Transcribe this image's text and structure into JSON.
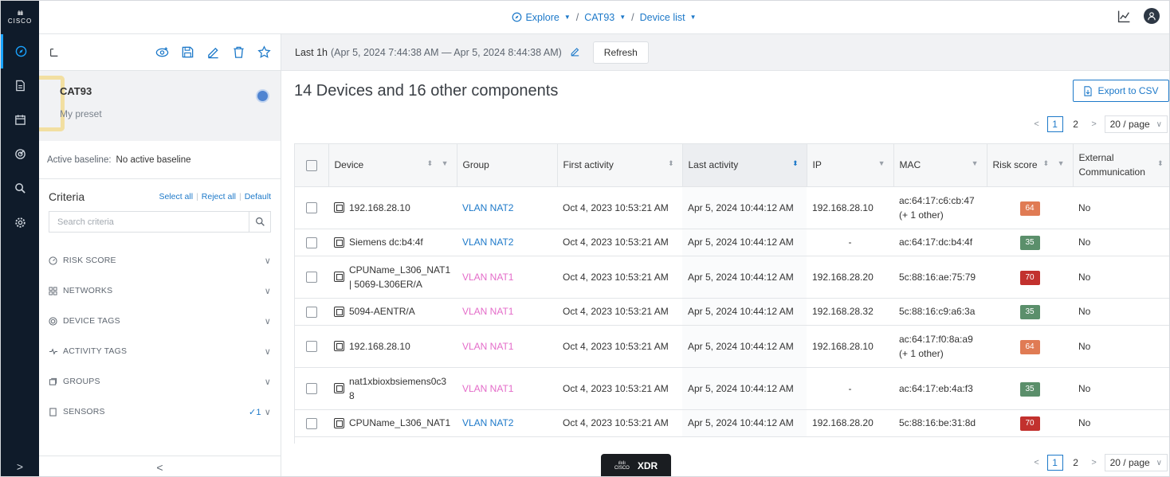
{
  "brand": {
    "bars": "ılıılı",
    "word": "CISCO"
  },
  "topbar": {
    "explore": "Explore",
    "preset": "CAT93",
    "view": "Device list"
  },
  "left_panel": {
    "preset_name": "CAT93",
    "preset_sub": "My preset",
    "baseline_label": "Active baseline:",
    "baseline_value": "No active baseline",
    "criteria_title": "Criteria",
    "select_all": "Select all",
    "reject_all": "Reject all",
    "default": "Default",
    "search_placeholder": "Search criteria",
    "criteria": [
      {
        "label": "RISK SCORE"
      },
      {
        "label": "NETWORKS"
      },
      {
        "label": "DEVICE TAGS"
      },
      {
        "label": "ACTIVITY TAGS"
      },
      {
        "label": "GROUPS"
      },
      {
        "label": "SENSORS",
        "count": "✓1"
      }
    ]
  },
  "main": {
    "time_label": "Last 1h",
    "time_range": "(Apr 5, 2024 7:44:38 AM — Apr 5, 2024 8:44:38 AM)",
    "refresh": "Refresh",
    "title": "14 Devices and 16 other components",
    "export": "Export to CSV",
    "pager": {
      "page1": "1",
      "page2": "2",
      "size": "20 / page"
    }
  },
  "table": {
    "columns": [
      "Device",
      "Group",
      "First activity",
      "Last activity",
      "IP",
      "MAC",
      "Risk score",
      "External Communication"
    ],
    "rows": [
      {
        "device": "192.168.28.10",
        "group": "VLAN NAT2",
        "group_color": "blue",
        "first": "Oct 4, 2023 10:53:21 AM",
        "last": "Apr 5, 2024 10:44:12 AM",
        "ip": "192.168.28.10",
        "mac": "ac:64:17:c6:cb:47",
        "mac2": "(+ 1 other)",
        "risk": "64",
        "ext": "No"
      },
      {
        "device": "Siemens dc:b4:4f",
        "group": "VLAN NAT2",
        "group_color": "blue",
        "first": "Oct 4, 2023 10:53:21 AM",
        "last": "Apr 5, 2024 10:44:12 AM",
        "ip": "-",
        "mac": "ac:64:17:dc:b4:4f",
        "mac2": "",
        "risk": "35",
        "ext": "No"
      },
      {
        "device": "CPUName_L306_NAT1 | 5069-L306ER/A",
        "group": "VLAN NAT1",
        "group_color": "pink",
        "first": "Oct 4, 2023 10:53:21 AM",
        "last": "Apr 5, 2024 10:44:12 AM",
        "ip": "192.168.28.20",
        "mac": "5c:88:16:ae:75:79",
        "mac2": "",
        "risk": "70",
        "ext": "No"
      },
      {
        "device": "5094-AENTR/A",
        "group": "VLAN NAT1",
        "group_color": "pink",
        "first": "Oct 4, 2023 10:53:21 AM",
        "last": "Apr 5, 2024 10:44:12 AM",
        "ip": "192.168.28.32",
        "mac": "5c:88:16:c9:a6:3a",
        "mac2": "",
        "risk": "35",
        "ext": "No"
      },
      {
        "device": "192.168.28.10",
        "group": "VLAN NAT1",
        "group_color": "pink",
        "first": "Oct 4, 2023 10:53:21 AM",
        "last": "Apr 5, 2024 10:44:12 AM",
        "ip": "192.168.28.10",
        "mac": "ac:64:17:f0:8a:a9",
        "mac2": "(+ 1 other)",
        "risk": "64",
        "ext": "No"
      },
      {
        "device": "nat1xbioxbsiemens0c3 8",
        "group": "VLAN NAT1",
        "group_color": "pink",
        "first": "Oct 4, 2023 10:53:21 AM",
        "last": "Apr 5, 2024 10:44:12 AM",
        "ip": "-",
        "mac": "ac:64:17:eb:4a:f3",
        "mac2": "",
        "risk": "35",
        "ext": "No"
      },
      {
        "device": "CPUName_L306_NAT1",
        "group": "VLAN NAT2",
        "group_color": "blue",
        "first": "Oct 4, 2023 10:53:21 AM",
        "last": "Apr 5, 2024 10:44:12 AM",
        "ip": "192.168.28.20",
        "mac": "5c:88:16:be:31:8d",
        "mac2": "",
        "risk": "70",
        "ext": "No"
      }
    ]
  },
  "colors": {
    "risk_64": "#e07b54",
    "risk_35": "#5b8f6b",
    "risk_70": "#c2312e",
    "accent": "#1d79c9",
    "pink": "#e46cc9"
  },
  "xdr": {
    "label": "XDR",
    "mini_bars": "ılıılı",
    "mini_word": "CISCO"
  }
}
